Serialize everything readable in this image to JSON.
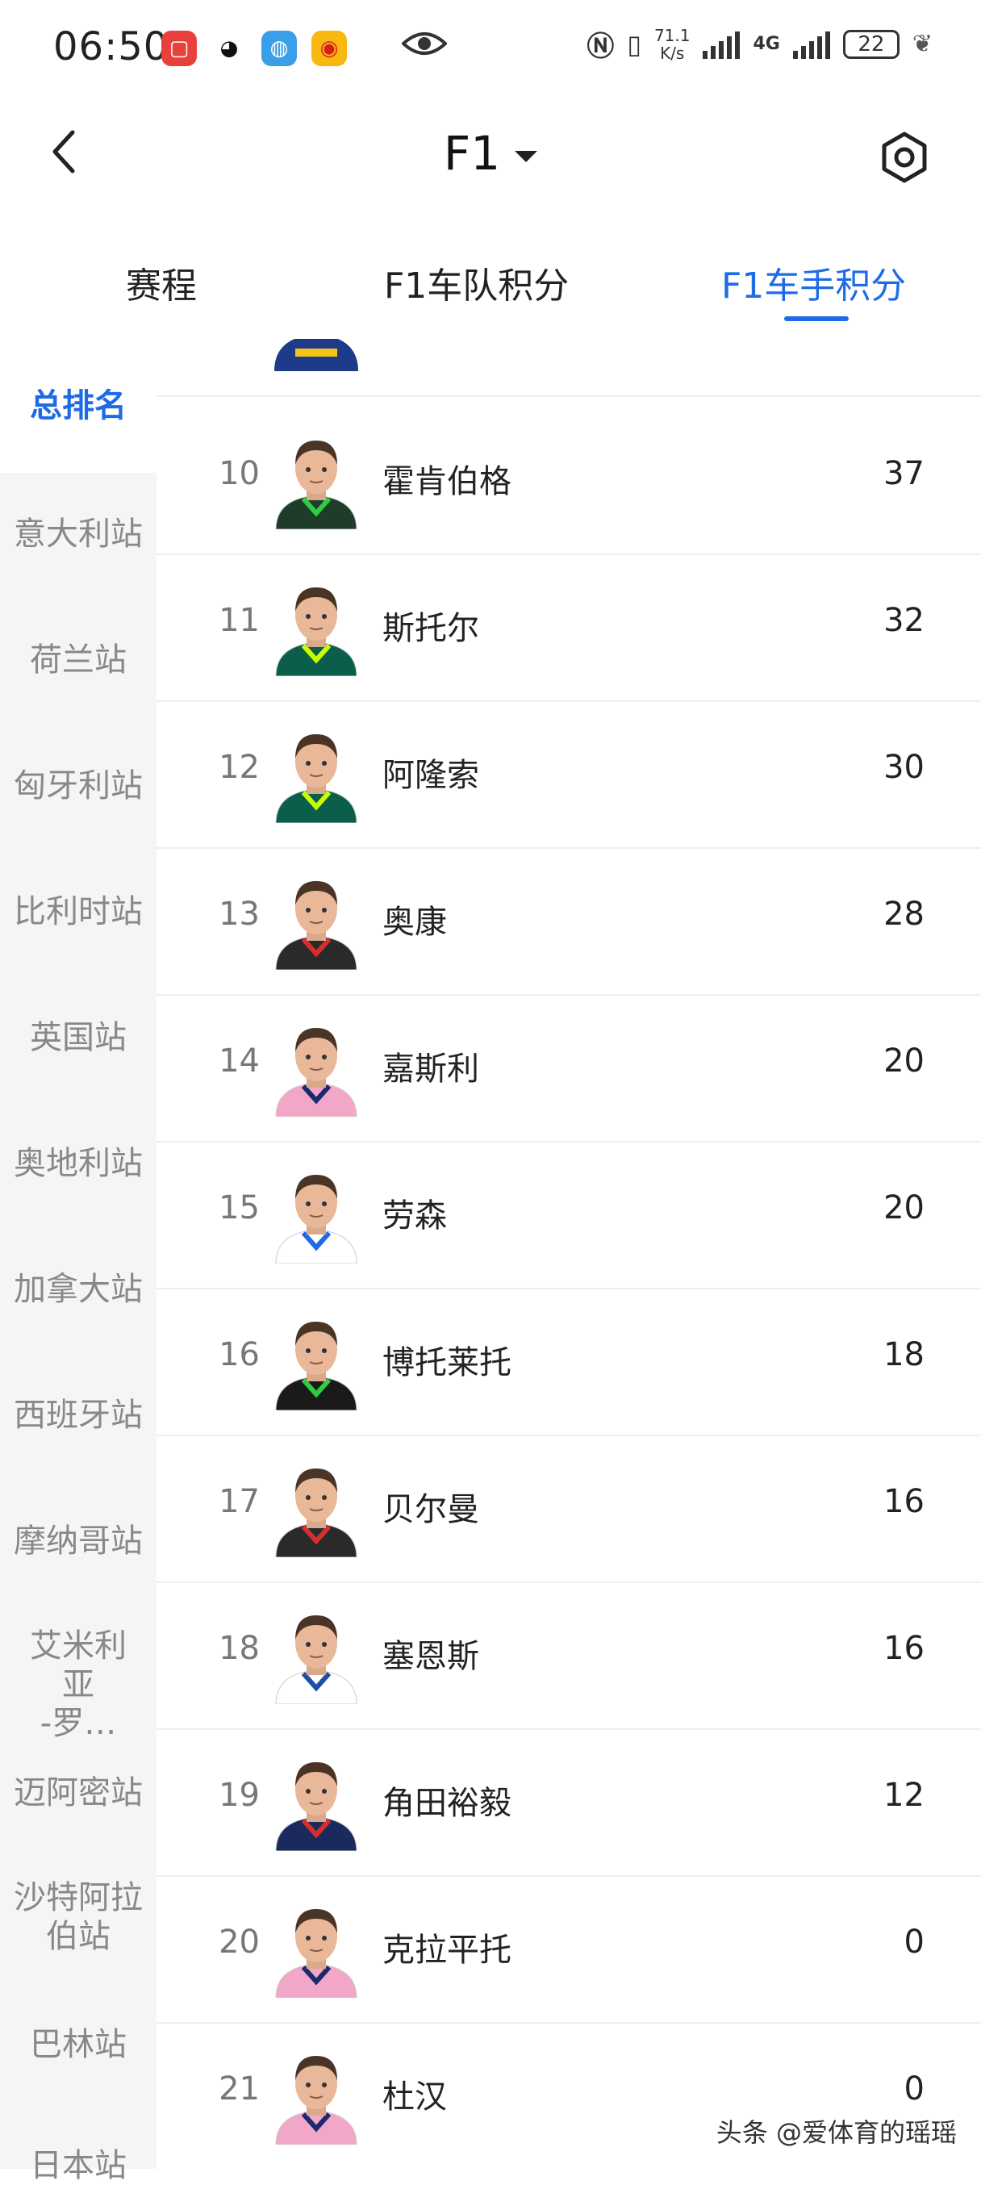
{
  "status": {
    "time": "06:50",
    "net_speed_value": "71.1",
    "net_speed_unit": "K/s",
    "network": "4G",
    "battery": "22"
  },
  "header": {
    "title": "F1"
  },
  "tabs": [
    {
      "label": "赛程"
    },
    {
      "label": "F1车队积分"
    },
    {
      "label": "F1车手积分"
    }
  ],
  "sidebar": {
    "items": [
      {
        "label": "总排名"
      },
      {
        "label": "意大利站"
      },
      {
        "label": "荷兰站"
      },
      {
        "label": "匈牙利站"
      },
      {
        "label": "比利时站"
      },
      {
        "label": "英国站"
      },
      {
        "label": "奥地利站"
      },
      {
        "label": "加拿大站"
      },
      {
        "label": "西班牙站"
      },
      {
        "label": "摩纳哥站"
      },
      {
        "label": "艾米利亚-罗…"
      },
      {
        "label": "迈阿密站"
      },
      {
        "label": "沙特阿拉伯站"
      },
      {
        "label": "巴林站"
      },
      {
        "label": "日本站"
      }
    ]
  },
  "drivers": [
    {
      "rank": "10",
      "name": "霍肯伯格",
      "points": "37",
      "suit_color": "#1f3b2a",
      "accent": "#2ecc40"
    },
    {
      "rank": "11",
      "name": "斯托尔",
      "points": "32",
      "suit_color": "#0b5e4a",
      "accent": "#c8ff00"
    },
    {
      "rank": "12",
      "name": "阿隆索",
      "points": "30",
      "suit_color": "#0b5e4a",
      "accent": "#c8ff00"
    },
    {
      "rank": "13",
      "name": "奥康",
      "points": "28",
      "suit_color": "#2a2a2a",
      "accent": "#d32f2f"
    },
    {
      "rank": "14",
      "name": "嘉斯利",
      "points": "20",
      "suit_color": "#f3a7c8",
      "accent": "#1a2a6c"
    },
    {
      "rank": "15",
      "name": "劳森",
      "points": "20",
      "suit_color": "#ffffff",
      "accent": "#1e6be6"
    },
    {
      "rank": "16",
      "name": "博托莱托",
      "points": "18",
      "suit_color": "#1a1a1a",
      "accent": "#2ecc40"
    },
    {
      "rank": "17",
      "name": "贝尔曼",
      "points": "16",
      "suit_color": "#2a2a2a",
      "accent": "#d32f2f"
    },
    {
      "rank": "18",
      "name": "塞恩斯",
      "points": "16",
      "suit_color": "#ffffff",
      "accent": "#1e4fa8"
    },
    {
      "rank": "19",
      "name": "角田裕毅",
      "points": "12",
      "suit_color": "#1b2a5c",
      "accent": "#d32f2f"
    },
    {
      "rank": "20",
      "name": "克拉平托",
      "points": "0",
      "suit_color": "#f3a7c8",
      "accent": "#1a2a6c"
    },
    {
      "rank": "21",
      "name": "杜汉",
      "points": "0",
      "suit_color": "#f3a7c8",
      "accent": "#1a2a6c"
    }
  ],
  "watermark": "头条 @爱体育的瑶瑶",
  "colors": {
    "accent": "#1e6be6",
    "sidebar_bg": "#f5f5f5"
  }
}
